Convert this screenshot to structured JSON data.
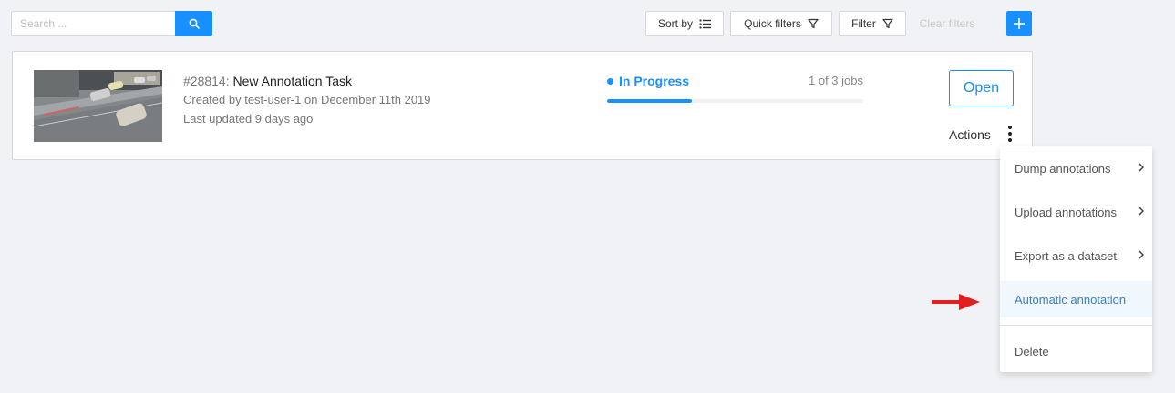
{
  "search": {
    "placeholder": "Search ...",
    "value": ""
  },
  "toolbar": {
    "sort_label": "Sort by",
    "quick_filters_label": "Quick filters",
    "filter_label": "Filter",
    "clear_filters_label": "Clear filters",
    "add_icon": "plus-icon"
  },
  "task": {
    "id_label": "#28814:",
    "name": "New Annotation Task",
    "created_prefix": "Created by",
    "owner": "test-user-1",
    "created_date": "on December 11th 2019",
    "updated": "Last updated 9 days ago",
    "status": "In Progress",
    "jobs": "1 of 3 jobs",
    "progress_fraction": 0.33,
    "open_label": "Open",
    "actions_label": "Actions"
  },
  "actions_menu": {
    "items": [
      {
        "label": "Dump annotations",
        "has_submenu": true
      },
      {
        "label": "Upload annotations",
        "has_submenu": true
      },
      {
        "label": "Export as a dataset",
        "has_submenu": true
      },
      {
        "label": "Automatic annotation",
        "has_submenu": false,
        "highlighted": true
      },
      {
        "label": "Delete",
        "has_submenu": false
      }
    ]
  },
  "colors": {
    "accent": "#1890ff",
    "background": "#f0f2f5",
    "annotation_arrow": "#e02020"
  }
}
